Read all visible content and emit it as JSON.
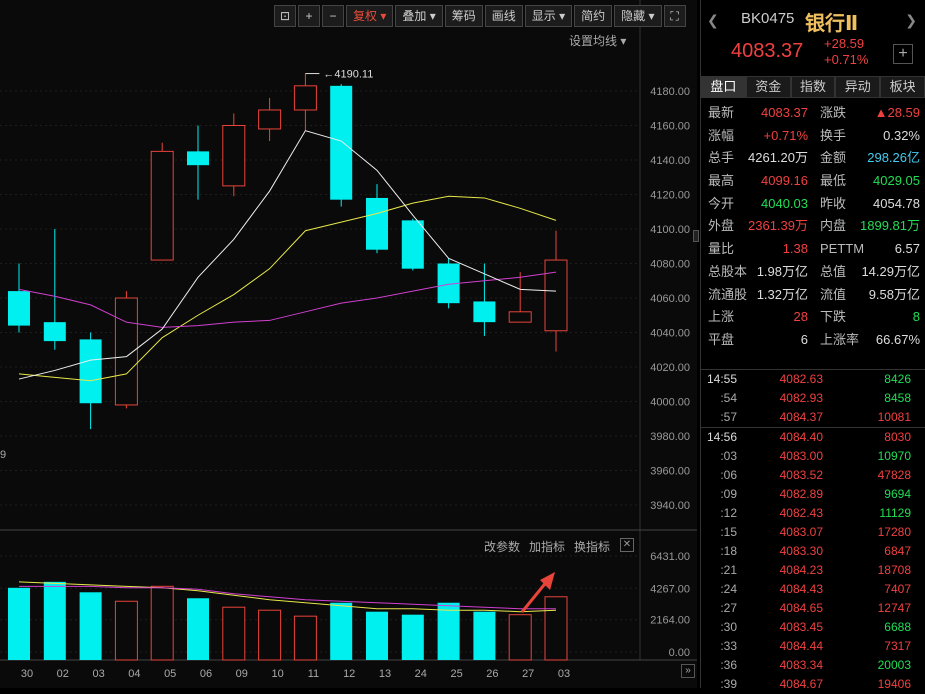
{
  "toolbar": {
    "buttons": [
      "复权",
      "叠加",
      "筹码",
      "画线",
      "显示",
      "简约",
      "隐藏"
    ],
    "active": "复权"
  },
  "chart": {
    "ma_setting_label": "设置均线",
    "y_ticks": [
      "4180.00",
      "4160.00",
      "4140.00",
      "4120.00",
      "4100.00",
      "4080.00",
      "4060.00",
      "4040.00",
      "4020.00",
      "4000.00",
      "3980.00",
      "3960.00",
      "3940.00"
    ],
    "high_label": "4190.11",
    "left_partial_label": "9",
    "x_labels": [
      "30",
      "02",
      "03",
      "04",
      "05",
      "06",
      "09",
      "10",
      "11",
      "12",
      "13",
      "24",
      "25",
      "26",
      "27",
      "03"
    ],
    "candles": [
      {
        "o": 4064,
        "c": 4044,
        "h": 4080,
        "l": 4040,
        "up": false
      },
      {
        "o": 4046,
        "c": 4035,
        "h": 4100,
        "l": 4030,
        "up": false
      },
      {
        "o": 4036,
        "c": 3999,
        "h": 4040,
        "l": 3984,
        "up": false
      },
      {
        "o": 3998,
        "c": 4060,
        "h": 4064,
        "l": 3996,
        "up": true
      },
      {
        "o": 4082,
        "c": 4145,
        "h": 4150,
        "l": 4082,
        "up": true
      },
      {
        "o": 4145,
        "c": 4137,
        "h": 4160,
        "l": 4117,
        "up": false
      },
      {
        "o": 4125,
        "c": 4160,
        "h": 4167,
        "l": 4119,
        "up": true
      },
      {
        "o": 4158,
        "c": 4169,
        "h": 4176,
        "l": 4151,
        "up": true
      },
      {
        "o": 4169,
        "c": 4183,
        "h": 4190.11,
        "l": 4157,
        "up": true
      },
      {
        "o": 4183,
        "c": 4117,
        "h": 4184,
        "l": 4113,
        "up": false
      },
      {
        "o": 4118,
        "c": 4088,
        "h": 4126,
        "l": 4086,
        "up": false
      },
      {
        "o": 4105,
        "c": 4077,
        "h": 4106,
        "l": 4076,
        "up": false
      },
      {
        "o": 4080,
        "c": 4057,
        "h": 4083,
        "l": 4054,
        "up": false
      },
      {
        "o": 4058,
        "c": 4046,
        "h": 4080,
        "l": 4038,
        "up": false
      },
      {
        "o": 4046,
        "c": 4052,
        "h": 4075,
        "l": 4046,
        "up": true
      },
      {
        "o": 4041,
        "c": 4082,
        "h": 4099,
        "l": 4029,
        "up": true
      }
    ],
    "ma_white": [
      4013,
      4018,
      4024,
      4026,
      4042,
      4072,
      4094,
      4122,
      4157,
      4151,
      4134,
      4108,
      4083,
      4074,
      4065,
      4064
    ],
    "ma_yellow": [
      4016,
      4014,
      4012,
      4016,
      4037,
      4050,
      4062,
      4077,
      4099,
      4104,
      4109,
      4115,
      4119,
      4118,
      4112,
      4105
    ],
    "ma_magenta": [
      4065,
      4061,
      4056,
      4046,
      4043,
      4044,
      4046,
      4047,
      4052,
      4057,
      4060,
      4064,
      4068,
      4070,
      4072,
      4075
    ],
    "indicator": {
      "tools": [
        "改参数",
        "加指标",
        "换指标"
      ],
      "y_ticks": [
        "6431.00",
        "4267.00",
        "2164.00",
        "0.00"
      ],
      "bars": [
        4300,
        4700,
        4000,
        3400,
        4400,
        3600,
        3000,
        2800,
        2400,
        3300,
        2700,
        2500,
        3300,
        2700,
        2500,
        3700
      ],
      "line_yellow": [
        4700,
        4600,
        4500,
        4400,
        4300,
        4100,
        3800,
        3500,
        3300,
        3100,
        2900,
        2900,
        2800,
        2800,
        2700,
        2800
      ],
      "line_magenta": [
        4400,
        4400,
        4400,
        4300,
        4300,
        4200,
        3900,
        3700,
        3500,
        3400,
        3300,
        3200,
        3100,
        3000,
        2900,
        2900
      ]
    }
  },
  "panel": {
    "code": "BK0475",
    "name": "银行Ⅱ",
    "price": "4083.37",
    "change": "+28.59",
    "change_pct": "+0.71%",
    "tabs": [
      "盘口",
      "资金",
      "指数",
      "异动",
      "板块"
    ],
    "stats": [
      [
        {
          "l": "最新",
          "v": "4083.37",
          "c": "red"
        },
        {
          "l": "涨跌",
          "v": "▲28.59",
          "c": "red"
        }
      ],
      [
        {
          "l": "涨幅",
          "v": "+0.71%",
          "c": "red"
        },
        {
          "l": "换手",
          "v": "0.32%",
          "c": "wht"
        }
      ],
      [
        {
          "l": "总手",
          "v": "4261.20万",
          "c": "wht"
        },
        {
          "l": "金额",
          "v": "298.26亿",
          "c": "cyn"
        }
      ],
      [
        {
          "l": "最高",
          "v": "4099.16",
          "c": "red"
        },
        {
          "l": "最低",
          "v": "4029.05",
          "c": "grn"
        }
      ],
      [
        {
          "l": "今开",
          "v": "4040.03",
          "c": "grn"
        },
        {
          "l": "昨收",
          "v": "4054.78",
          "c": "wht"
        }
      ],
      [
        {
          "l": "外盘",
          "v": "2361.39万",
          "c": "red"
        },
        {
          "l": "内盘",
          "v": "1899.81万",
          "c": "grn"
        }
      ],
      [
        {
          "l": "量比",
          "v": "1.38",
          "c": "red"
        },
        {
          "l": "PETTM",
          "v": "6.57",
          "c": "wht"
        }
      ],
      [
        {
          "l": "总股本",
          "v": "1.98万亿",
          "c": "wht"
        },
        {
          "l": "总值",
          "v": "14.29万亿",
          "c": "wht"
        }
      ],
      [
        {
          "l": "流通股",
          "v": "1.32万亿",
          "c": "wht"
        },
        {
          "l": "流值",
          "v": "9.58万亿",
          "c": "wht"
        }
      ],
      [
        {
          "l": "上涨",
          "v": "28",
          "c": "red"
        },
        {
          "l": "下跌",
          "v": "8",
          "c": "grn"
        }
      ],
      [
        {
          "l": "平盘",
          "v": "6",
          "c": "wht"
        },
        {
          "l": "上涨率",
          "v": "66.67%",
          "c": "wht"
        }
      ]
    ],
    "ticks": [
      {
        "t": "14:55",
        "p": "4082.63",
        "v": "8426",
        "big": true,
        "vc": "grn"
      },
      {
        "t": ":54",
        "p": "4082.93",
        "v": "8458",
        "vc": "grn"
      },
      {
        "t": ":57",
        "p": "4084.37",
        "v": "10081",
        "vc": "red"
      },
      {
        "sep": true
      },
      {
        "t": "14:56",
        "p": "4084.40",
        "v": "8030",
        "big": true,
        "vc": "red"
      },
      {
        "t": ":03",
        "p": "4083.00",
        "v": "10970",
        "vc": "grn"
      },
      {
        "t": ":06",
        "p": "4083.52",
        "v": "47828",
        "vc": "red"
      },
      {
        "t": ":09",
        "p": "4082.89",
        "v": "9694",
        "vc": "grn"
      },
      {
        "t": ":12",
        "p": "4082.43",
        "v": "11129",
        "vc": "grn"
      },
      {
        "t": ":15",
        "p": "4083.07",
        "v": "17280",
        "vc": "red"
      },
      {
        "t": ":18",
        "p": "4083.30",
        "v": "6847",
        "vc": "red"
      },
      {
        "t": ":21",
        "p": "4084.23",
        "v": "18708",
        "vc": "red"
      },
      {
        "t": ":24",
        "p": "4084.43",
        "v": "7407",
        "vc": "red"
      },
      {
        "t": ":27",
        "p": "4084.65",
        "v": "12747",
        "vc": "red"
      },
      {
        "t": ":30",
        "p": "4083.45",
        "v": "6688",
        "vc": "grn"
      },
      {
        "t": ":33",
        "p": "4084.44",
        "v": "7317",
        "vc": "red"
      },
      {
        "t": ":36",
        "p": "4083.34",
        "v": "20003",
        "vc": "grn"
      },
      {
        "t": ":39",
        "p": "4084.67",
        "v": "19406",
        "vc": "red"
      }
    ]
  }
}
